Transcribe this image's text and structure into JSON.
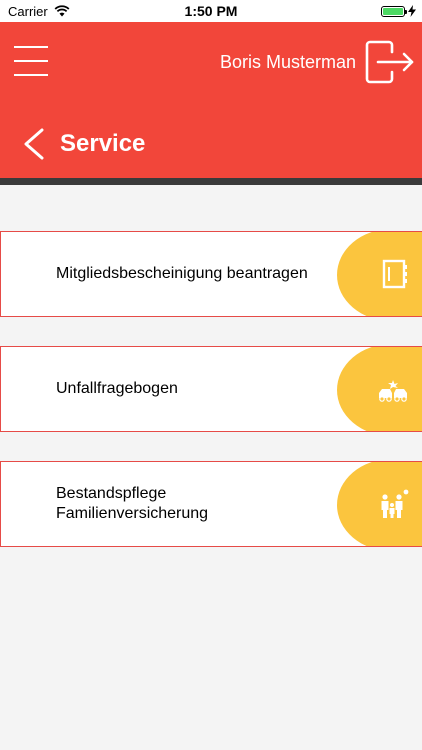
{
  "status_bar": {
    "carrier": "Carrier",
    "time": "1:50 PM",
    "battery_icon": "battery-icon",
    "wifi_icon": "wifi-icon",
    "charging_icon": "bolt-icon"
  },
  "header": {
    "user_name": "Boris Musterman",
    "title": "Service",
    "menu_icon": "hamburger-menu-icon",
    "logout_icon": "logout-icon",
    "back_icon": "chevron-left-icon",
    "background_color": "#f2463a",
    "divider_color": "#3a3a3a"
  },
  "service_items": [
    {
      "label_lines": [
        "Mitgliedsbescheinigung beantragen"
      ],
      "icon": "notebook-icon"
    },
    {
      "label_lines": [
        "Unfallfragebogen"
      ],
      "icon": "car-accident-icon"
    },
    {
      "label_lines": [
        "Bestandspflege",
        "Familienversicherung"
      ],
      "icon": "family-icon"
    }
  ],
  "colors": {
    "accent_yellow": "#fbc53e",
    "card_border": "#e64b47",
    "page_background": "#f4f4f4"
  }
}
